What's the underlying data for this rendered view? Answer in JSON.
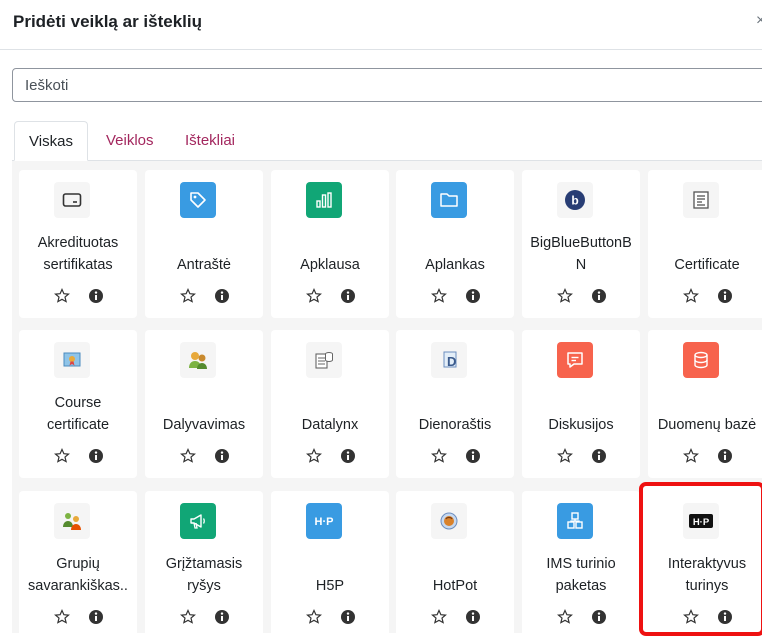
{
  "modal": {
    "title": "Pridėti veiklą ar išteklių",
    "close_symbol": "×"
  },
  "search": {
    "placeholder": "Ieškoti"
  },
  "tabs": [
    {
      "label": "Viskas",
      "active": true
    },
    {
      "label": "Veiklos",
      "active": false
    },
    {
      "label": "Ištekliai",
      "active": false
    }
  ],
  "colors": {
    "accent": "#a3275e",
    "blue": "#399be2",
    "green": "#11a676",
    "red": "#f7634d",
    "grey_tile": "#f5f5f5",
    "highlight": "#ee1111"
  },
  "items": [
    {
      "name": "Akredituotas sertifikatas",
      "lines": [
        "Akredituotas",
        "sertifikatas"
      ],
      "icon": "certificate-outline-icon"
    },
    {
      "name": "Antraštė",
      "lines": [
        "Antraštė"
      ],
      "icon": "tag-icon"
    },
    {
      "name": "Apklausa",
      "lines": [
        "Apklausa"
      ],
      "icon": "bar-chart-icon"
    },
    {
      "name": "Aplankas",
      "lines": [
        "Aplankas"
      ],
      "icon": "folder-icon"
    },
    {
      "name": "BigBlueButtonBN",
      "lines": [
        "BigBlueButtonB",
        "N"
      ],
      "icon": "bigbluebutton-icon"
    },
    {
      "name": "Certificate",
      "lines": [
        "Certificate"
      ],
      "icon": "certificate-doc-icon"
    },
    {
      "name": "Course certificate",
      "lines": [
        "Course",
        "certificate"
      ],
      "icon": "course-certificate-icon"
    },
    {
      "name": "Dalyvavimas",
      "lines": [
        "Dalyvavimas"
      ],
      "icon": "attendance-people-icon"
    },
    {
      "name": "Datalynx",
      "lines": [
        "Datalynx"
      ],
      "icon": "datalynx-icon"
    },
    {
      "name": "Dienoraštis",
      "lines": [
        "Dienoraštis"
      ],
      "icon": "journal-icon"
    },
    {
      "name": "Diskusijos",
      "lines": [
        "Diskusijos"
      ],
      "icon": "forum-icon"
    },
    {
      "name": "Duomenų bazė",
      "lines": [
        "Duomenų bazė"
      ],
      "icon": "database-icon"
    },
    {
      "name": "Grupių savarankiškas...",
      "lines": [
        "Grupių",
        "savarankiškas.."
      ],
      "icon": "group-selfselection-icon"
    },
    {
      "name": "Grįžtamasis ryšys",
      "lines": [
        "Grįžtamasis",
        "ryšys"
      ],
      "icon": "megaphone-icon"
    },
    {
      "name": "H5P",
      "lines": [
        "H5P"
      ],
      "icon": "h5p-icon"
    },
    {
      "name": "HotPot",
      "lines": [
        "HotPot"
      ],
      "icon": "hotpot-icon"
    },
    {
      "name": "IMS turinio paketas",
      "lines": [
        "IMS turinio",
        "paketas"
      ],
      "icon": "ims-package-icon"
    },
    {
      "name": "Interaktyvus turinys",
      "lines": [
        "Interaktyvus",
        "turinys"
      ],
      "icon": "h5p-dark-icon",
      "highlighted": true
    }
  ]
}
